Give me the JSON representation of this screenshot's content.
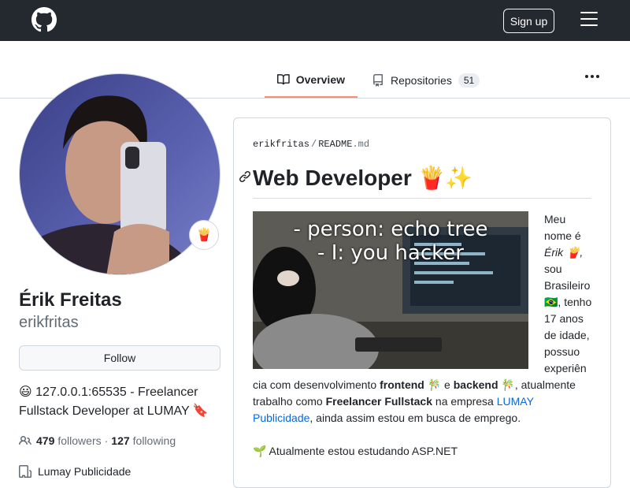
{
  "header": {
    "signup_label": "Sign up"
  },
  "tabs": {
    "overview_label": "Overview",
    "repositories_label": "Repositories",
    "repositories_count": "51"
  },
  "profile": {
    "status_emoji": "🍟",
    "full_name": "Érik Freitas",
    "login": "erikfritas",
    "follow_label": "Follow",
    "bio_emoji": "😃",
    "bio_text": "127.0.0.1:65535 - Freelancer Fullstack Developer at LUMAY",
    "bio_end_emoji": "🔖",
    "followers_count": "479",
    "followers_label": "followers",
    "dot": "·",
    "following_count": "127",
    "following_label": "following",
    "organization": "Lumay Publicidade"
  },
  "readme": {
    "owner": "erikfritas",
    "separator": "/",
    "file_name": "README",
    "file_ext": ".md",
    "heading": "Web Developer 🍟✨",
    "gif_line1": "- person: echo tree",
    "gif_line2": "- I: you hacker",
    "side_text": {
      "l1": "Meu",
      "l2": "nome é",
      "l3": "Érik 🍟,",
      "l4": "sou",
      "l5": "Brasileiro",
      "l6": "🇧🇷, tenho",
      "l7": "17 anos",
      "l8": "de idade,",
      "l9": "possuo",
      "l10": "experiên"
    },
    "para": {
      "t1": "cia com desenvolvimento ",
      "b1": "frontend",
      "e1": " 🎋 e ",
      "b2": "backend",
      "e2": " 🎋, atualmente trabalho como ",
      "b3": "Freelancer Fullstack",
      "t2": " na empresa ",
      "link": "LUMAY Publicidade",
      "t3": ", ainda assim estou em busca de emprego."
    },
    "studying": "🌱 Atualmente estou estudando ASP.NET"
  },
  "colors": {
    "header_bg": "#24292f",
    "tab_underline": "#fd8c73",
    "link": "#0969da"
  }
}
